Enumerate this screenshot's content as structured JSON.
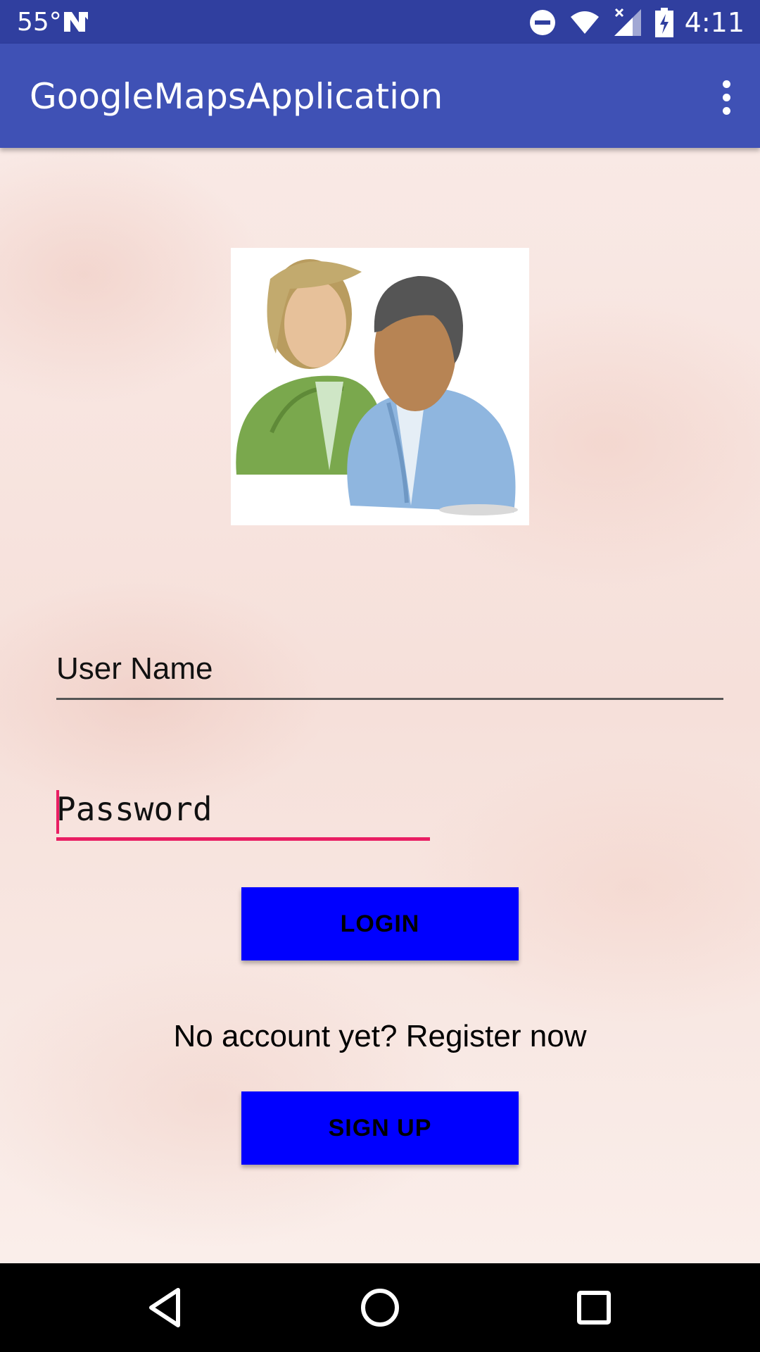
{
  "status_bar": {
    "temperature": "55°",
    "time": "4:11",
    "icons": [
      "n-notification-icon",
      "do-not-disturb-icon",
      "wifi-icon",
      "cell-signal-icon",
      "battery-charging-icon"
    ]
  },
  "app_bar": {
    "title": "GoogleMapsApplication",
    "overflow_icon": "more-vert-icon"
  },
  "login_form": {
    "image": "users-icon",
    "username": {
      "value": "User Name"
    },
    "password": {
      "value": "Password"
    },
    "login_label": "LOGIN",
    "register_prompt": "No account yet? Register now",
    "signup_label": "SIGN UP"
  },
  "nav_bar": {
    "icons": [
      "back-icon",
      "home-icon",
      "recents-icon"
    ]
  },
  "colors": {
    "status_bar": "#303f9f",
    "app_bar": "#3f51b5",
    "accent": "#e91e63",
    "button": "#0000ff",
    "nav_bar": "#000000"
  }
}
